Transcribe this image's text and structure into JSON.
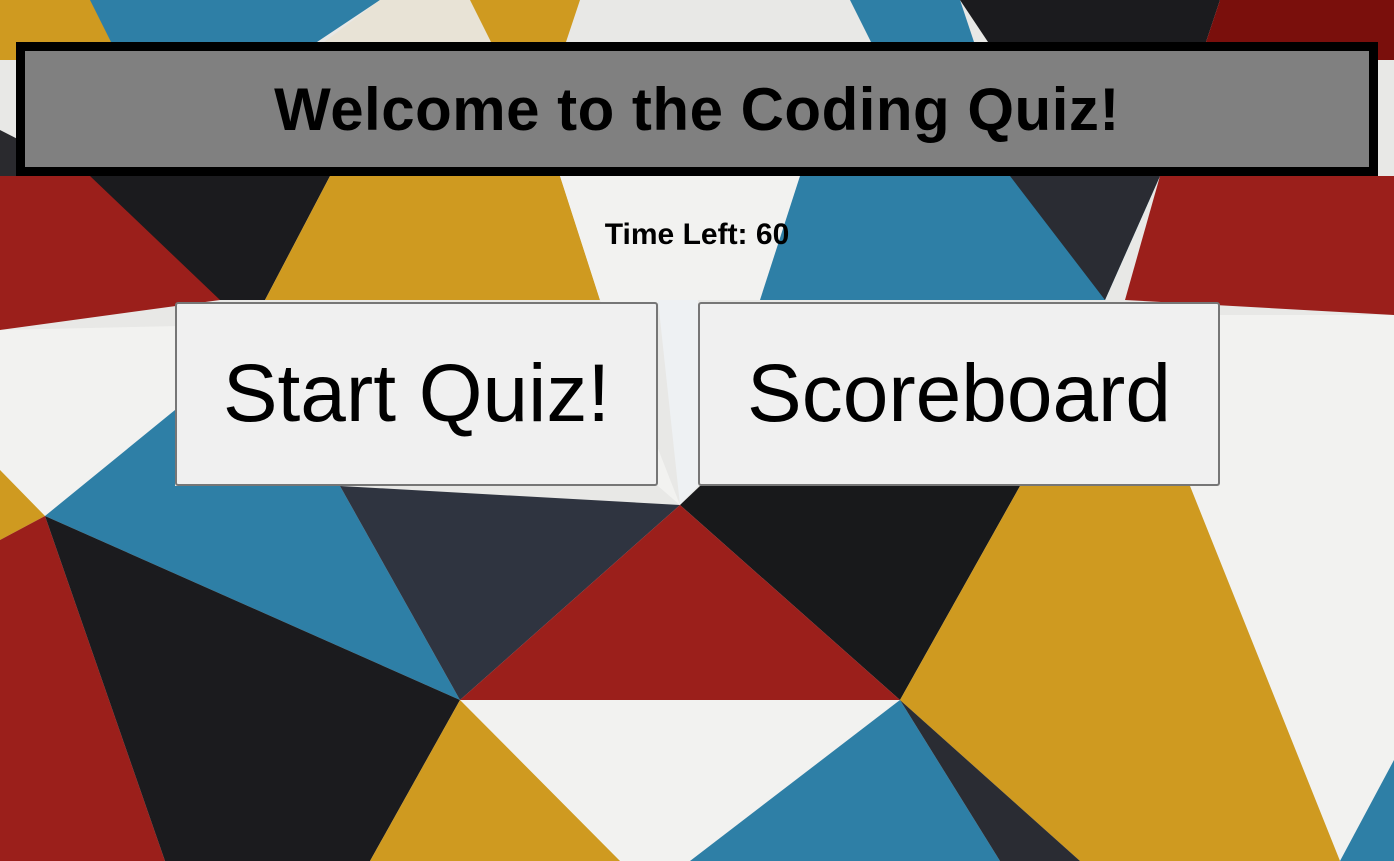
{
  "header": {
    "title": "Welcome to the Coding Quiz!"
  },
  "timer": {
    "text": "Time Left: 60"
  },
  "buttons": {
    "start_label": "Start Quiz!",
    "scoreboard_label": "Scoreboard"
  },
  "colors": {
    "banner_bg": "#808080",
    "banner_border": "#000000",
    "button_bg": "#f0f0f0",
    "bg_red": "#9b1f1b",
    "bg_blue": "#2e7fa6",
    "bg_yellow": "#cf9a20",
    "bg_black": "#1b1b1e",
    "bg_white": "#eeeeee"
  }
}
